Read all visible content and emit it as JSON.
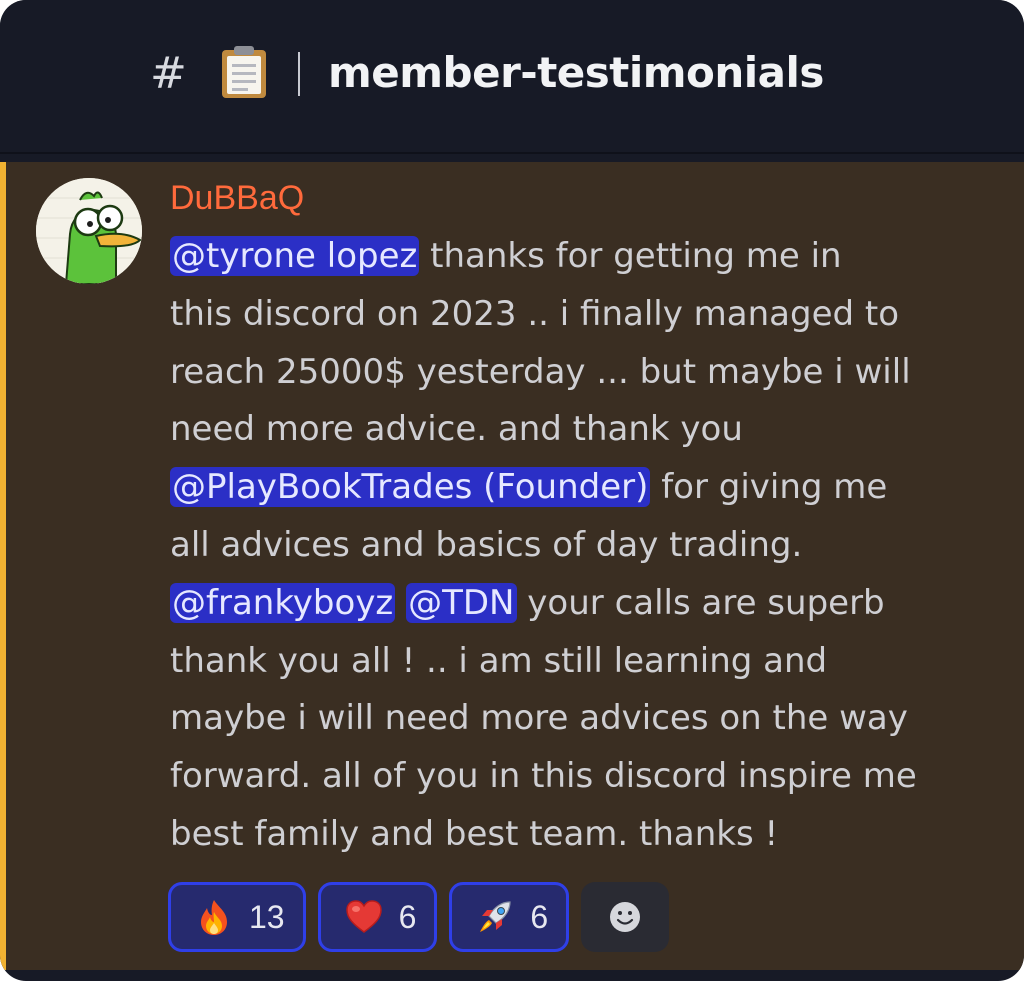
{
  "channel": {
    "hash": "#",
    "name": "member-testimonials",
    "icon": "clipboard-icon"
  },
  "message": {
    "author": "DuBBaQ",
    "author_color": "#ff6a3c",
    "accent_color": "#f0b232",
    "mentions": {
      "m1": "@tyrone lopez",
      "m2": "@PlayBookTrades (Founder)",
      "m3": "@frankyboyz",
      "m4": "@TDN"
    },
    "lines": {
      "l1_after": " thanks for getting me in",
      "l2": "this discord on 2023 .. i finally managed to",
      "l3": "reach 25000$ yesterday ... but maybe i will",
      "l4": "need more advice. and thank you",
      "l5_after": " for giving me",
      "l6": "all advices and basics of day trading.",
      "l7_between": " ",
      "l7_after": " your calls are superb",
      "l8": "thank you all ! .. i am still learning and",
      "l9": "maybe i will need more advices on the way",
      "l10": "forward. all of you in this discord inspire me",
      "l11": "best family and best team. thanks !"
    }
  },
  "reactions": [
    {
      "emoji": "fire-icon",
      "count": "13"
    },
    {
      "emoji": "heart-icon",
      "count": "6"
    },
    {
      "emoji": "rocket-icon",
      "count": "6"
    }
  ],
  "add_reaction": {
    "icon": "smiley-icon"
  }
}
